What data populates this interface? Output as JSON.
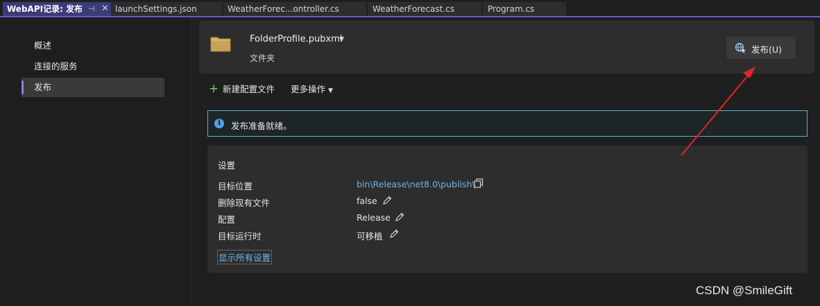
{
  "tabs": [
    {
      "label": "WebAPI记录: 发布",
      "active": true,
      "pin_icon": "pin-icon",
      "close_icon": "close-icon"
    },
    {
      "label": "launchSettings.json"
    },
    {
      "label": "WeatherForec...ontroller.cs"
    },
    {
      "label": "WeatherForecast.cs"
    },
    {
      "label": "Program.cs"
    }
  ],
  "tab_symbols": {
    "pin": "⊣",
    "close": "✕"
  },
  "sidebar": {
    "items": [
      {
        "label": "概述"
      },
      {
        "label": "连接的服务"
      },
      {
        "label": "发布",
        "selected": true
      }
    ]
  },
  "profile": {
    "name": "FolderProfile.pubxml",
    "type": "文件夹",
    "icon": "folder-icon",
    "publish_button": "发布(U)",
    "publish_icon": "publish-globe-icon"
  },
  "toolbar": {
    "new_profile": "新建配置文件",
    "more_actions": "更多操作"
  },
  "info": {
    "icon": "info-icon",
    "text": "发布准备就绪。"
  },
  "settings": {
    "title": "设置",
    "rows": [
      {
        "label": "目标位置",
        "value": "bin\\Release\\net8.0\\publish\\",
        "action_icon": "copy-icon"
      },
      {
        "label": "删除现有文件",
        "value": "false",
        "action_icon": "edit-icon"
      },
      {
        "label": "配置",
        "value": "Release",
        "action_icon": "edit-icon"
      },
      {
        "label": "目标运行时",
        "value": "可移植",
        "action_icon": "edit-icon"
      }
    ],
    "show_all": "显示所有设置"
  },
  "watermark": "CSDN @SmileGift",
  "colors": {
    "accent": "#6b57c5",
    "link": "#6eb5ea",
    "info_border": "#5fb2c8",
    "annotation_arrow": "#e0262a"
  }
}
